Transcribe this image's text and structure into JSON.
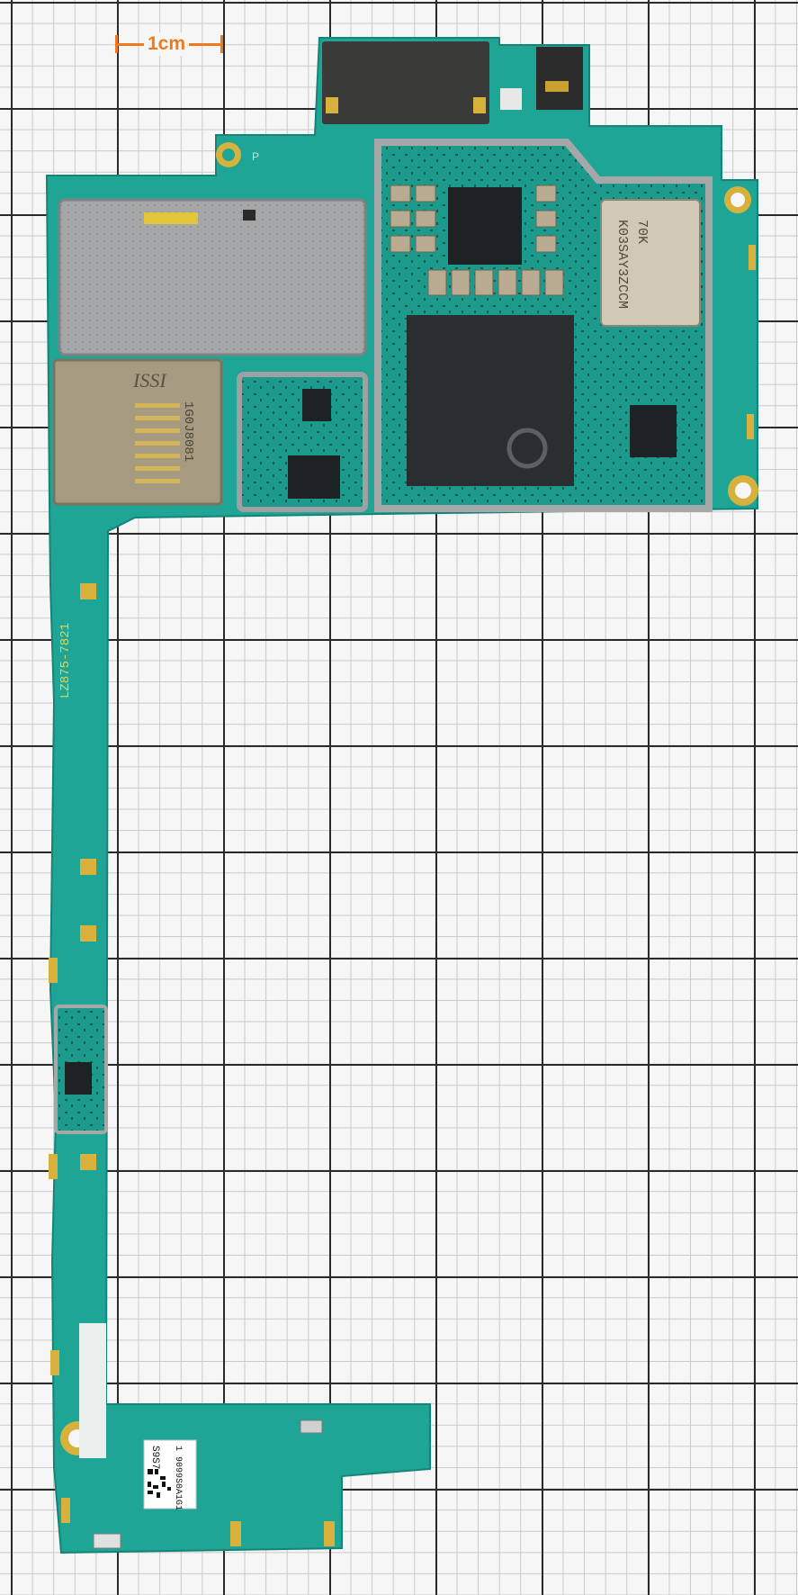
{
  "scale_label": "1cm",
  "silkscreen": {
    "board_code": "LZ875-7821",
    "memory_brand": "ISSI",
    "memory_code": "1G0J8081",
    "module_code": "K03SAY3ZCCM",
    "module_sub": "70K",
    "test_point": "P",
    "label_code": "S9S7",
    "label_serial": "1 9099S0A1G1"
  },
  "colors": {
    "pcb": "#1fa595",
    "pcb_dark": "#168c7e",
    "gold": "#d8b13c",
    "shield": "#9ea0a2",
    "scale": "#f07a1a"
  }
}
